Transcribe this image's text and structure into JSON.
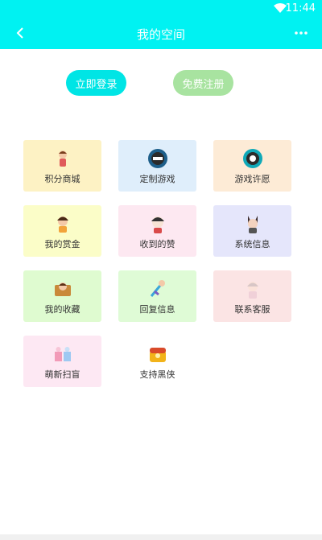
{
  "status_bar": {
    "time": "11:44"
  },
  "header": {
    "title": "我的空间",
    "bg": "#00f2f2"
  },
  "auth": {
    "login_label": "立即登录",
    "register_label": "免费注册"
  },
  "tiles": [
    {
      "label": "积分商城",
      "icon": "girl-shopping-icon",
      "bg": "#fdf2c4"
    },
    {
      "label": "定制游戏",
      "icon": "game-logo-icon",
      "bg": "#dfeefb"
    },
    {
      "label": "游戏许愿",
      "icon": "wish-badge-icon",
      "bg": "#fdebd6"
    },
    {
      "label": "我的赏金",
      "icon": "bounty-character-icon",
      "bg": "#fbfdc8"
    },
    {
      "label": "收到的赞",
      "icon": "likes-character-icon",
      "bg": "#fde8f1"
    },
    {
      "label": "系统信息",
      "icon": "system-message-icon",
      "bg": "#e5e6fb"
    },
    {
      "label": "我的收藏",
      "icon": "favorites-icon",
      "bg": "#dffbd0"
    },
    {
      "label": "回复信息",
      "icon": "reply-message-icon",
      "bg": "#dffbd6"
    },
    {
      "label": "联系客服",
      "icon": "customer-service-icon",
      "bg": "#fbe4e4"
    },
    {
      "label": "萌新扫盲",
      "icon": "newbie-guide-icon",
      "bg": "#fde8f3"
    },
    {
      "label": "支持黑侠",
      "icon": "support-chest-icon",
      "bg": "#ffffff"
    }
  ]
}
